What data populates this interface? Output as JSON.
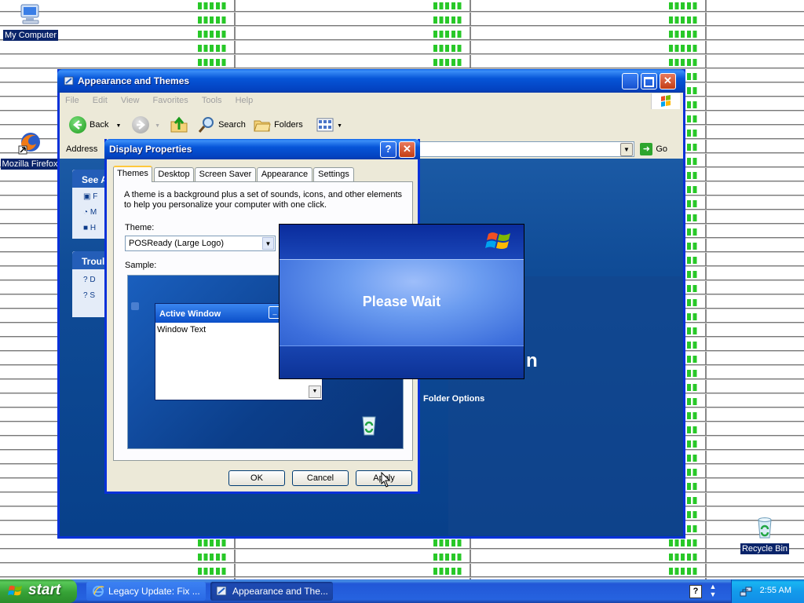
{
  "desktop": {
    "icons": [
      {
        "label": "My Computer"
      },
      {
        "label": "Mozilla Firefox"
      },
      {
        "label": "Recycle Bin"
      }
    ]
  },
  "explorer": {
    "title": "Appearance and Themes",
    "menu": [
      "File",
      "Edit",
      "View",
      "Favorites",
      "Tools",
      "Help"
    ],
    "toolbar": {
      "back": "Back",
      "search": "Search",
      "folders": "Folders"
    },
    "address_label": "Address",
    "go_label": "Go",
    "panes": [
      {
        "title": "See A",
        "items": [
          "F",
          "M",
          "H"
        ]
      },
      {
        "title": "Troul",
        "items": [
          "D",
          "S"
        ]
      }
    ],
    "big_text": "n",
    "folder_options": "Folder Options"
  },
  "display_properties": {
    "title": "Display Properties",
    "tabs": [
      "Themes",
      "Desktop",
      "Screen Saver",
      "Appearance",
      "Settings"
    ],
    "active_tab": "Themes",
    "description": "A theme is a background plus a set of sounds, icons, and other elements to help you personalize your computer with one click.",
    "theme_label": "Theme:",
    "theme_value": "POSReady (Large Logo)",
    "sample_label": "Sample:",
    "sample_window_title": "Active Window",
    "sample_window_text": "Window Text",
    "buttons": {
      "ok": "OK",
      "cancel": "Cancel",
      "apply": "Apply"
    }
  },
  "please_wait": {
    "message": "Please Wait"
  },
  "taskbar": {
    "start_label": "start",
    "tasks": [
      {
        "label": "Legacy Update: Fix ..."
      },
      {
        "label": "Appearance and The..."
      }
    ],
    "clock": "2:55 AM"
  },
  "colors": {
    "xp_blue": "#0831d9",
    "start_green": "#36a236",
    "wallpaper_green": "#28c828"
  }
}
